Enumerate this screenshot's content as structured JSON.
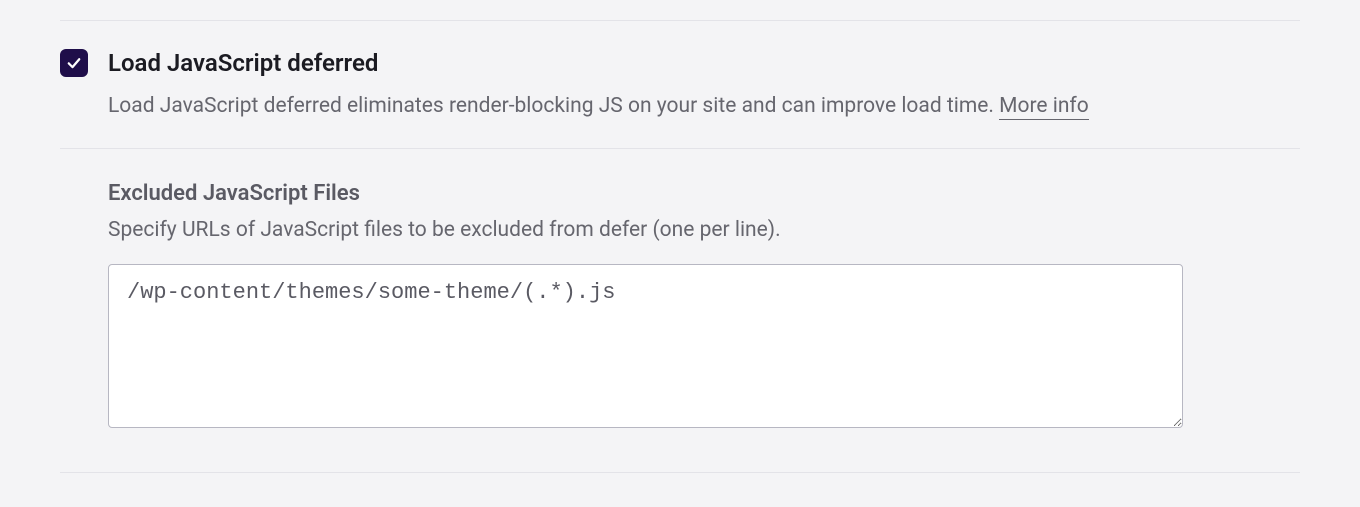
{
  "defer": {
    "checked": true,
    "title": "Load JavaScript deferred",
    "description_prefix": "Load JavaScript deferred eliminates render-blocking JS on your site and can improve load time. ",
    "more_info_label": "More info"
  },
  "excluded": {
    "title": "Excluded JavaScript Files",
    "description": "Specify URLs of JavaScript files to be excluded from defer (one per line).",
    "value": "/wp-content/themes/some-theme/(.*).js"
  }
}
